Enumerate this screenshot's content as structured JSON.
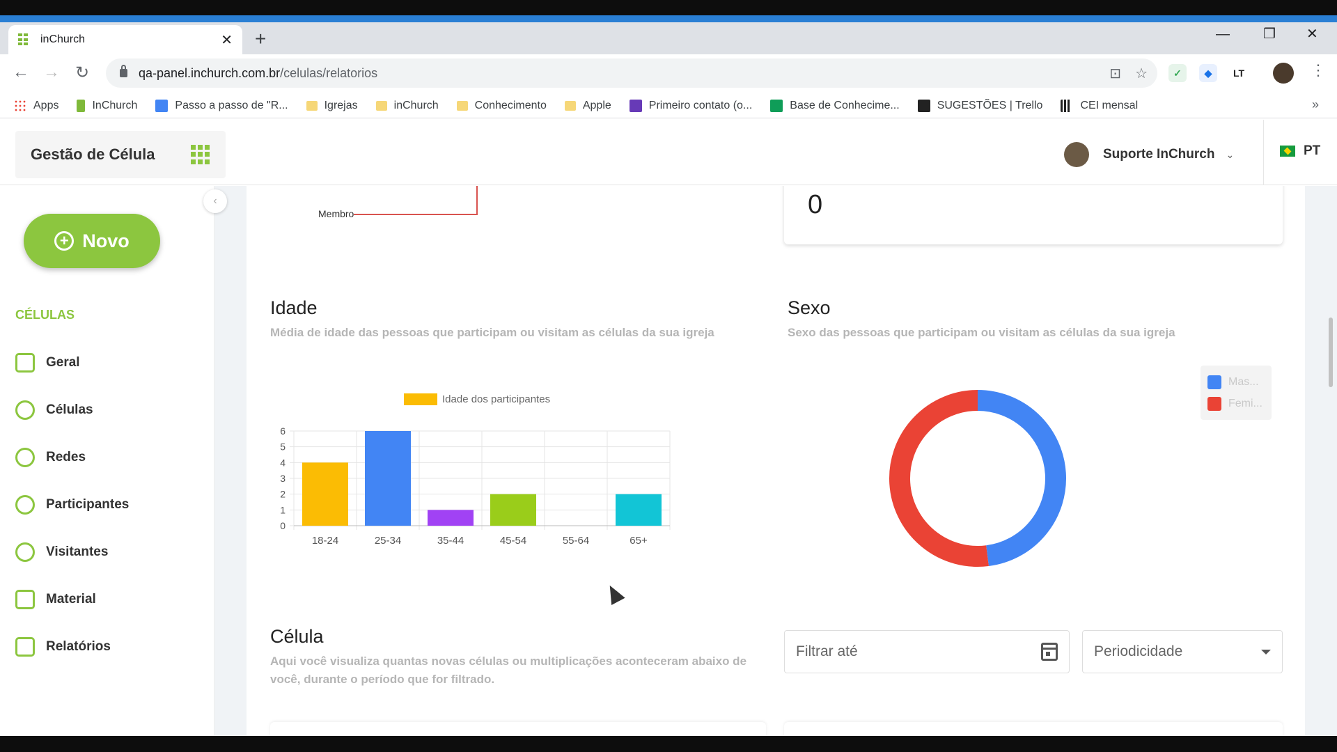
{
  "browser": {
    "tab_title": "inChurch",
    "url_domain": "qa-panel.inchurch.com.br",
    "url_path": "/celulas/relatorios",
    "bookmarks": [
      {
        "label": "Apps",
        "icon": "apps-grid-icon",
        "color": "#e94235"
      },
      {
        "label": "InChurch",
        "icon": "inchurch-icon",
        "color": "#7fb93a"
      },
      {
        "label": "Passo a passo de \"R...",
        "icon": "docs-icon",
        "color": "#4285f4"
      },
      {
        "label": "Igrejas",
        "icon": "folder-icon",
        "color": "#f6d778"
      },
      {
        "label": "inChurch",
        "icon": "folder-icon",
        "color": "#f6d778"
      },
      {
        "label": "Conhecimento",
        "icon": "folder-icon",
        "color": "#f6d778"
      },
      {
        "label": "Apple",
        "icon": "folder-icon",
        "color": "#f6d778"
      },
      {
        "label": "Primeiro contato (o...",
        "icon": "forms-icon",
        "color": "#673ab7"
      },
      {
        "label": "Base de Conhecime...",
        "icon": "sheets-icon",
        "color": "#0f9d58"
      },
      {
        "label": "SUGESTÕES | Trello",
        "icon": "trello-icon",
        "color": "#222222"
      },
      {
        "label": "CEI mensal",
        "icon": "bar-chart-icon",
        "color": "#222222"
      }
    ]
  },
  "header": {
    "brand": "Gestão de Célula",
    "user_name": "Suporte InChurch",
    "language": "PT"
  },
  "sidebar": {
    "new_button": "Novo",
    "section_label": "CÉLULAS",
    "items": [
      {
        "label": "Geral",
        "icon": "dashboard-icon"
      },
      {
        "label": "Células",
        "icon": "cells-icon"
      },
      {
        "label": "Redes",
        "icon": "globe-icon"
      },
      {
        "label": "Participantes",
        "icon": "participants-icon"
      },
      {
        "label": "Visitantes",
        "icon": "visitors-icon"
      },
      {
        "label": "Material",
        "icon": "book-icon"
      },
      {
        "label": "Relatórios",
        "icon": "report-icon"
      }
    ]
  },
  "main": {
    "org_label": "Membro",
    "stat_value": "0",
    "age": {
      "title": "Idade",
      "subtitle": "Média de idade das pessoas que participam ou visitam as células da sua igreja"
    },
    "sex": {
      "title": "Sexo",
      "subtitle": "Sexo das pessoas que participam ou visitam as células da sua igreja",
      "legend": [
        {
          "label": "Mas...",
          "color": "#4285f4"
        },
        {
          "label": "Femi...",
          "color": "#ea4335"
        }
      ]
    },
    "cell": {
      "title": "Célula",
      "subtitle_line1": "Aqui você visualiza quantas novas células ou multiplicações aconteceram abaixo de",
      "subtitle_line2": "você, durante o período que for filtrado.",
      "filter_placeholder": "Filtrar até",
      "period_placeholder": "Periodicidade"
    }
  },
  "chart_data": [
    {
      "type": "bar",
      "title": "",
      "legend": "Idade dos participantes",
      "categories": [
        "18-24",
        "25-34",
        "35-44",
        "45-54",
        "55-64",
        "65+"
      ],
      "values": [
        4,
        6,
        1,
        2,
        0,
        2
      ],
      "colors": [
        "#fbbc04",
        "#4285f4",
        "#a142f4",
        "#9acd1a",
        "#cccccc",
        "#12c5d6"
      ],
      "ylim": [
        0,
        6
      ],
      "yticks": [
        0,
        1,
        2,
        3,
        4,
        5,
        6
      ],
      "grid": true,
      "legend_position": "top"
    },
    {
      "type": "pie",
      "style": "donut",
      "categories": [
        "Mas...",
        "Femi..."
      ],
      "values": [
        48,
        52
      ],
      "colors": [
        "#4285f4",
        "#ea4335"
      ],
      "legend_position": "right"
    }
  ]
}
